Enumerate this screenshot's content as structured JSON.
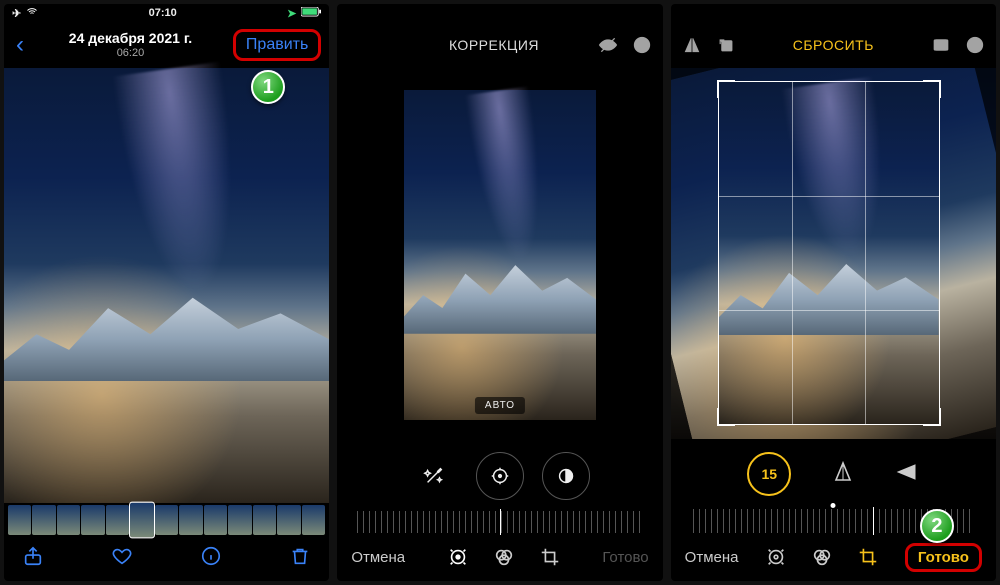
{
  "status": {
    "time": "07:10"
  },
  "panel1": {
    "date": "24 декабря 2021 г.",
    "time": "06:20",
    "edit_label": "Править",
    "step": "1"
  },
  "panel2": {
    "title": "КОРРЕКЦИЯ",
    "auto_label": "АВТО",
    "cancel": "Отмена",
    "done": "Готово"
  },
  "panel3": {
    "reset": "СБРОСИТЬ",
    "angle": "15",
    "cancel": "Отмена",
    "done": "Готово",
    "step": "2"
  }
}
